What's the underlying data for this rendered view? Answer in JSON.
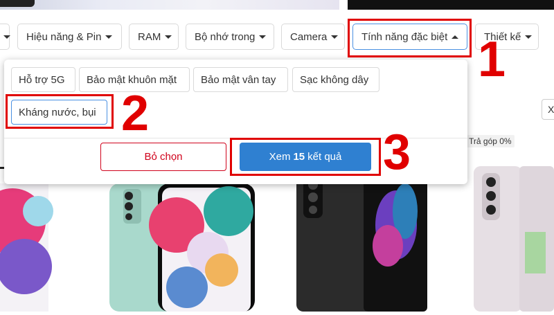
{
  "filter_bar": {
    "items": [
      {
        "label": ""
      },
      {
        "label": "Hiệu năng & Pin"
      },
      {
        "label": "RAM"
      },
      {
        "label": "Bộ nhớ trong"
      },
      {
        "label": "Camera"
      },
      {
        "label": "Tính năng đặc biệt"
      },
      {
        "label": "Thiết kế"
      }
    ]
  },
  "dropdown": {
    "options": [
      {
        "label": "Hỗ trợ 5G"
      },
      {
        "label": "Bảo mật khuôn mặt"
      },
      {
        "label": "Bảo mật vân tay"
      },
      {
        "label": "Sạc không dây"
      },
      {
        "label": "Kháng nước, bụi"
      }
    ],
    "clear_label": "Bỏ chọn",
    "view_prefix": "Xem",
    "view_count": "15",
    "view_suffix": "kết quả"
  },
  "annotations": {
    "step1": "1",
    "step2": "2",
    "step3": "3"
  },
  "product_list": {
    "installment_tag": "Trả góp 0%",
    "close_glyph": "X"
  },
  "colors": {
    "accent_red": "#e00000",
    "primary_blue": "#2f80d1",
    "clear_red": "#d0021b"
  }
}
